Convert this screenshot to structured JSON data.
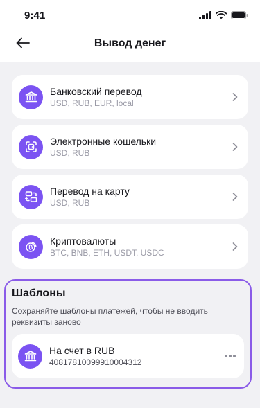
{
  "status_bar": {
    "time": "9:41",
    "icons": [
      "signal-icon",
      "wifi-icon",
      "battery-icon"
    ]
  },
  "nav": {
    "back_icon": "arrow-left-icon",
    "title": "Вывод денег"
  },
  "methods": [
    {
      "icon": "bank-icon",
      "title": "Банковский перевод",
      "subtitle": "USD, RUB, EUR, local"
    },
    {
      "icon": "wallet-icon",
      "title": "Электронные кошельки",
      "subtitle": "USD, RUB"
    },
    {
      "icon": "card-transfer-icon",
      "title": "Перевод на карту",
      "subtitle": "USD, RUB"
    },
    {
      "icon": "crypto-icon",
      "title": "Криптовалюты",
      "subtitle": "BTC, BNB, ETH, USDT, USDC"
    }
  ],
  "templates": {
    "title": "Шаблоны",
    "description": "Сохраняйте шаблоны платежей, чтобы не вводить реквизиты заново",
    "items": [
      {
        "icon": "bank-icon",
        "title": "На счет в RUB",
        "subtitle": "40817810099910004312"
      }
    ]
  },
  "colors": {
    "accent": "#7b53f2",
    "highlight_border": "#8a5be8",
    "background": "#f1f1f4",
    "card": "#ffffff",
    "muted_text": "#9a9aa6"
  }
}
